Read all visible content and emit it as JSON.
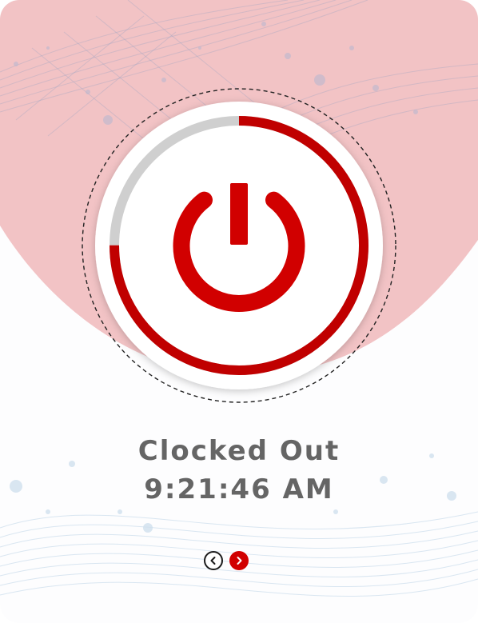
{
  "status": {
    "label": "Clocked Out",
    "time": "9:21:46 AM"
  },
  "power_button": {
    "icon": "power-icon",
    "progress_fraction": 0.75,
    "accent_color": "#c00000",
    "track_color": "#cfcfcf"
  },
  "nav": {
    "prev_icon": "chevron-left-icon",
    "next_icon": "chevron-right-icon"
  },
  "colors": {
    "header_background": "#f2c3c5",
    "text": "#656565",
    "nav_active": "#d10000"
  }
}
